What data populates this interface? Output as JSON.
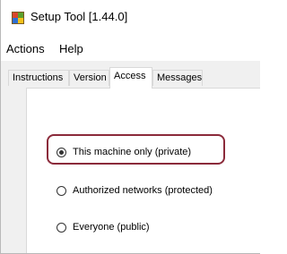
{
  "window": {
    "title": "Setup Tool [1.44.0]",
    "icon": "setup-tool-app-icon"
  },
  "menu": {
    "items": [
      {
        "label": "Actions"
      },
      {
        "label": "Help"
      }
    ]
  },
  "tabs": [
    {
      "label": "Instructions",
      "active": false
    },
    {
      "label": "Version",
      "active": false
    },
    {
      "label": "Access",
      "active": true
    },
    {
      "label": "Messages",
      "active": false
    }
  ],
  "access": {
    "options": [
      {
        "label": "This machine only (private)",
        "selected": true
      },
      {
        "label": "Authorized networks (protected)",
        "selected": false
      },
      {
        "label": "Everyone (public)",
        "selected": false
      }
    ]
  },
  "colors": {
    "highlight": "#8b2a3a",
    "tab_border": "#d9d9d9",
    "client_bg": "#f0f0f0"
  }
}
